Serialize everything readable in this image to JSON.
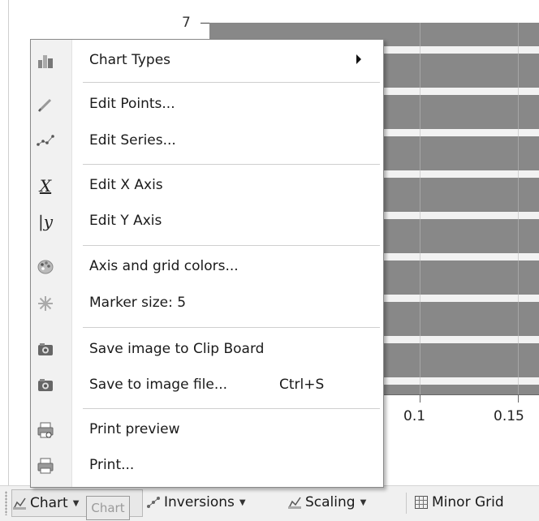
{
  "chart": {
    "y_tick_label": "7",
    "x_tick_labels": [
      "0.1",
      "0.15"
    ],
    "bar_color": "#888888"
  },
  "menu": {
    "items": [
      {
        "label": "Chart Types",
        "icon": "chart-types-icon",
        "submenu": true
      },
      {
        "label": "Edit Points...",
        "icon": "pencil-icon"
      },
      {
        "label": "Edit Series...",
        "icon": "series-icon"
      },
      {
        "label": "Edit X Axis",
        "icon": "x-axis-icon",
        "glyph": "X"
      },
      {
        "label": "Edit Y Axis",
        "icon": "y-axis-icon",
        "glyph": "|y"
      },
      {
        "label": "Axis and grid colors...",
        "icon": "palette-icon"
      },
      {
        "label": "Marker size: 5",
        "icon": "marker-icon"
      },
      {
        "label": "Save image to Clip Board",
        "icon": "camera-icon"
      },
      {
        "label": "Save to image file...",
        "icon": "camera-icon",
        "shortcut": "Ctrl+S"
      },
      {
        "label": "Print preview",
        "icon": "print-preview-icon"
      },
      {
        "label": "Print...",
        "icon": "printer-icon"
      }
    ]
  },
  "toolbar": {
    "chart_label": "Chart",
    "inversions_label": "Inversions",
    "scaling_label": "Scaling",
    "minor_grid_label": "Minor Grid",
    "tooltip": "Chart"
  }
}
